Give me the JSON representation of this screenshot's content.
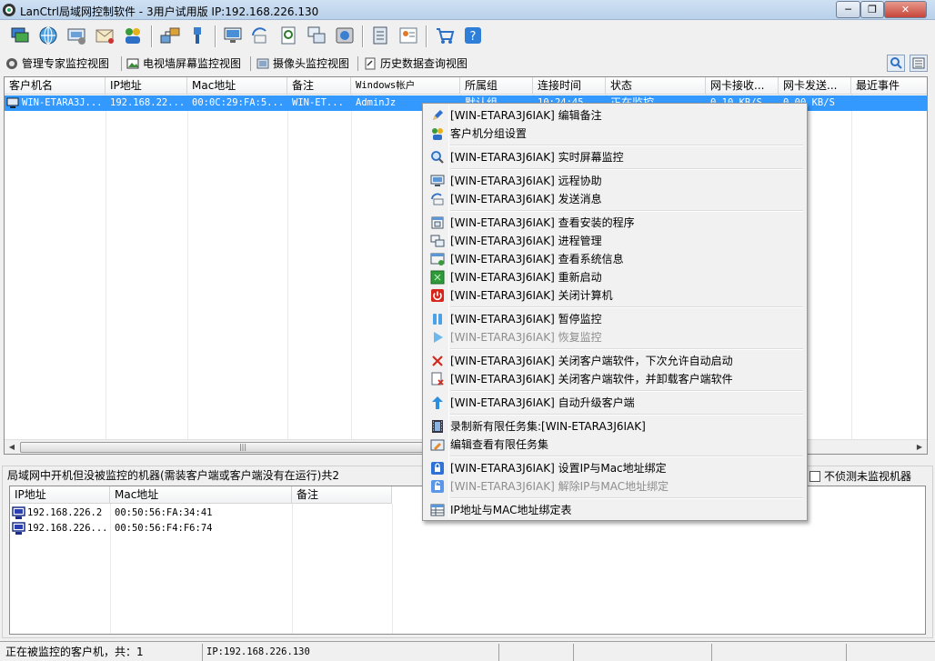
{
  "window": {
    "title": "LanCtrl局域网控制软件 - 3用户试用版 IP:192.168.226.130",
    "min_label": "─",
    "max_label": "❐",
    "close_label": "✕"
  },
  "toolbar": {
    "icons": [
      "computers-icon",
      "globe-icon",
      "remote-computer-icon",
      "mail-icon",
      "group-users-icon",
      "network-icon",
      "usb-icon",
      "monitor-icon",
      "send-message-icon",
      "document-search-icon",
      "windows-icon",
      "disk-icon",
      "server-list-icon",
      "user-card-icon",
      "cart-icon",
      "help-icon"
    ]
  },
  "tabs": [
    {
      "label": "管理专家监控视图",
      "icon": "expert-icon"
    },
    {
      "label": "电视墙屏幕监控视图",
      "icon": "tv-wall-icon"
    },
    {
      "label": "摄像头监控视图",
      "icon": "camera-icon"
    },
    {
      "label": "历史数据查询视图",
      "icon": "history-icon"
    }
  ],
  "main_list": {
    "columns": [
      "客户机名",
      "IP地址",
      "Mac地址",
      "备注",
      "Windows帐户",
      "所属组",
      "连接时间",
      "状态",
      "网卡接收...",
      "网卡发送...",
      "最近事件"
    ],
    "selected_row": {
      "name": "WIN-ETARA3J...",
      "ip": "192.168.22...",
      "mac": "00:0C:29:FA:5...",
      "note": "WIN-ET...",
      "account": "AdminJz",
      "group": "默认组",
      "time": "10:24:45",
      "status": "正在监控",
      "recv": "0.10 KB/S",
      "send": "0.00 KB/S",
      "event": ""
    },
    "scroll_grip": "|||"
  },
  "offline_group": {
    "label": "局域网中开机但没被监控的机器(需装客户端或客户端没有在运行)共2",
    "no_detect_label": "不侦测未监视机器",
    "columns": [
      "IP地址",
      "Mac地址",
      "备注"
    ],
    "rows": [
      {
        "ip": "192.168.226.2",
        "mac": "00:50:56:FA:34:41",
        "note": ""
      },
      {
        "ip": "192.168.226...",
        "mac": "00:50:56:F4:F6:74",
        "note": ""
      }
    ]
  },
  "statusbar": {
    "monitored": "正在被监控的客户机，共：1",
    "ip": "IP:192.168.226.130"
  },
  "context_menu": {
    "items": [
      {
        "label": "[WIN-ETARA3J6IAK] 编辑备注",
        "icon": "pencil-icon",
        "disabled": false
      },
      {
        "label": "客户机分组设置",
        "icon": "group-icon",
        "disabled": false
      },
      {
        "label": "[WIN-ETARA3J6IAK] 实时屏幕监控",
        "icon": "magnifier-icon",
        "disabled": false
      },
      {
        "label": "[WIN-ETARA3J6IAK] 远程协助",
        "icon": "remote-assist-icon",
        "disabled": false
      },
      {
        "label": "[WIN-ETARA3J6IAK] 发送消息",
        "icon": "message-icon",
        "disabled": false
      },
      {
        "label": "[WIN-ETARA3J6IAK] 查看安装的程序",
        "icon": "programs-icon",
        "disabled": false
      },
      {
        "label": "[WIN-ETARA3J6IAK] 进程管理",
        "icon": "process-icon",
        "disabled": false
      },
      {
        "label": "[WIN-ETARA3J6IAK] 查看系统信息",
        "icon": "system-info-icon",
        "disabled": false
      },
      {
        "label": "[WIN-ETARA3J6IAK] 重新启动",
        "icon": "restart-icon",
        "disabled": false
      },
      {
        "label": "[WIN-ETARA3J6IAK] 关闭计算机",
        "icon": "power-icon",
        "disabled": false
      },
      {
        "label": "[WIN-ETARA3J6IAK] 暂停监控",
        "icon": "pause-icon",
        "disabled": false
      },
      {
        "label": "[WIN-ETARA3J6IAK] 恢复监控",
        "icon": "play-icon",
        "disabled": true
      },
      {
        "label": "[WIN-ETARA3J6IAK] 关闭客户端软件，下次允许自动启动",
        "icon": "close-x-icon",
        "disabled": false
      },
      {
        "label": "[WIN-ETARA3J6IAK] 关闭客户端软件，并卸载客户端软件",
        "icon": "uninstall-icon",
        "disabled": false
      },
      {
        "label": "[WIN-ETARA3J6IAK] 自动升级客户端",
        "icon": "upgrade-icon",
        "disabled": false
      },
      {
        "label": "录制新有限任务集:[WIN-ETARA3J6IAK]",
        "icon": "film-icon",
        "disabled": false
      },
      {
        "label": "编辑查看有限任务集",
        "icon": "edit-task-icon",
        "disabled": false
      },
      {
        "label": "[WIN-ETARA3J6IAK] 设置IP与Mac地址绑定",
        "icon": "lock-icon",
        "disabled": false
      },
      {
        "label": "[WIN-ETARA3J6IAK] 解除IP与MAC地址绑定",
        "icon": "unlock-icon",
        "disabled": true
      },
      {
        "label": "IP地址与MAC地址绑定表",
        "icon": "table-icon",
        "disabled": false
      }
    ]
  }
}
